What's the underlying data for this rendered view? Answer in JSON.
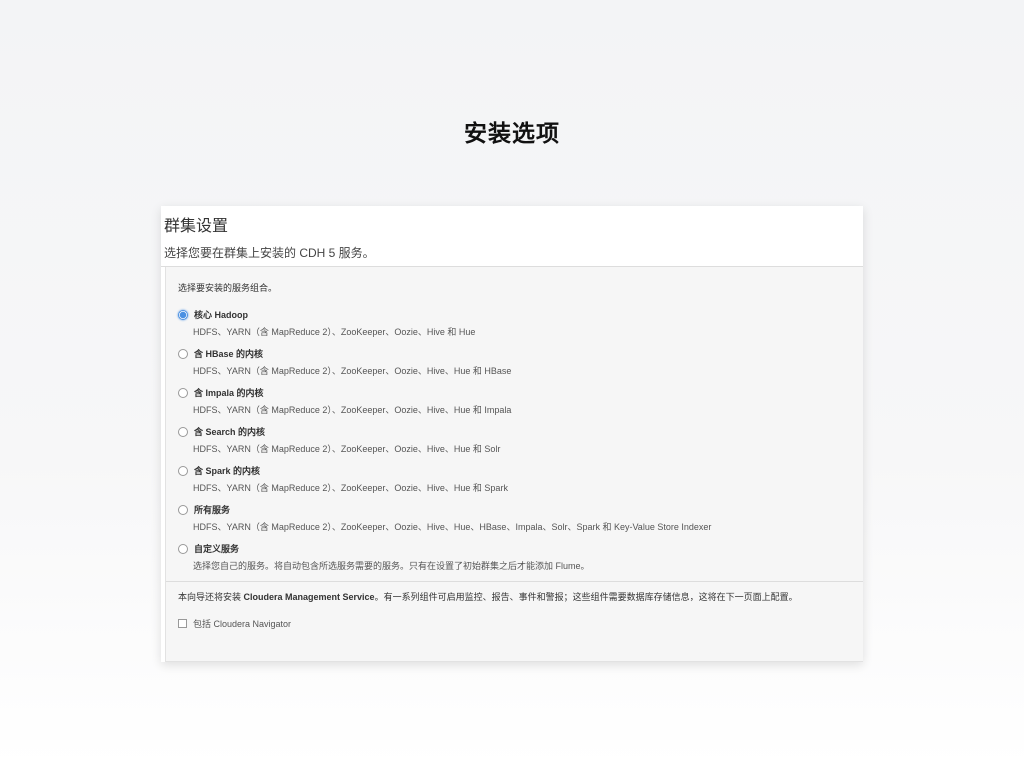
{
  "slide": {
    "title": "安装选项"
  },
  "panel": {
    "title": "群集设置",
    "subtitle": "选择您要在群集上安装的 CDH 5 服务。",
    "prompt": "选择要安装的服务组合。",
    "options": [
      {
        "label": "核心 Hadoop",
        "desc": "HDFS、YARN（含 MapReduce 2）、ZooKeeper、Oozie、Hive 和 Hue",
        "selected": true
      },
      {
        "label": "含 HBase 的内核",
        "desc": "HDFS、YARN（含 MapReduce 2）、ZooKeeper、Oozie、Hive、Hue 和 HBase",
        "selected": false
      },
      {
        "label": "含 Impala 的内核",
        "desc": "HDFS、YARN（含 MapReduce 2）、ZooKeeper、Oozie、Hive、Hue 和 Impala",
        "selected": false
      },
      {
        "label": "含 Search 的内核",
        "desc": "HDFS、YARN（含 MapReduce 2）、ZooKeeper、Oozie、Hive、Hue 和 Solr",
        "selected": false
      },
      {
        "label": "含 Spark 的内核",
        "desc": "HDFS、YARN（含 MapReduce 2）、ZooKeeper、Oozie、Hive、Hue 和 Spark",
        "selected": false
      },
      {
        "label": "所有服务",
        "desc": "HDFS、YARN（含 MapReduce 2）、ZooKeeper、Oozie、Hive、Hue、HBase、Impala、Solr、Spark 和 Key-Value Store Indexer",
        "selected": false
      },
      {
        "label": "自定义服务",
        "desc": "选择您自己的服务。将自动包含所选服务需要的服务。只有在设置了初始群集之后才能添加 Flume。",
        "selected": false
      }
    ],
    "note_prefix": "本向导还将安装 ",
    "note_bold": "Cloudera Management Service",
    "note_suffix": "。有一系列组件可启用监控、报告、事件和警报；这些组件需要数据库存储信息，这将在下一页面上配置。",
    "checkbox_label": "包括 Cloudera Navigator",
    "checkbox_checked": false
  }
}
